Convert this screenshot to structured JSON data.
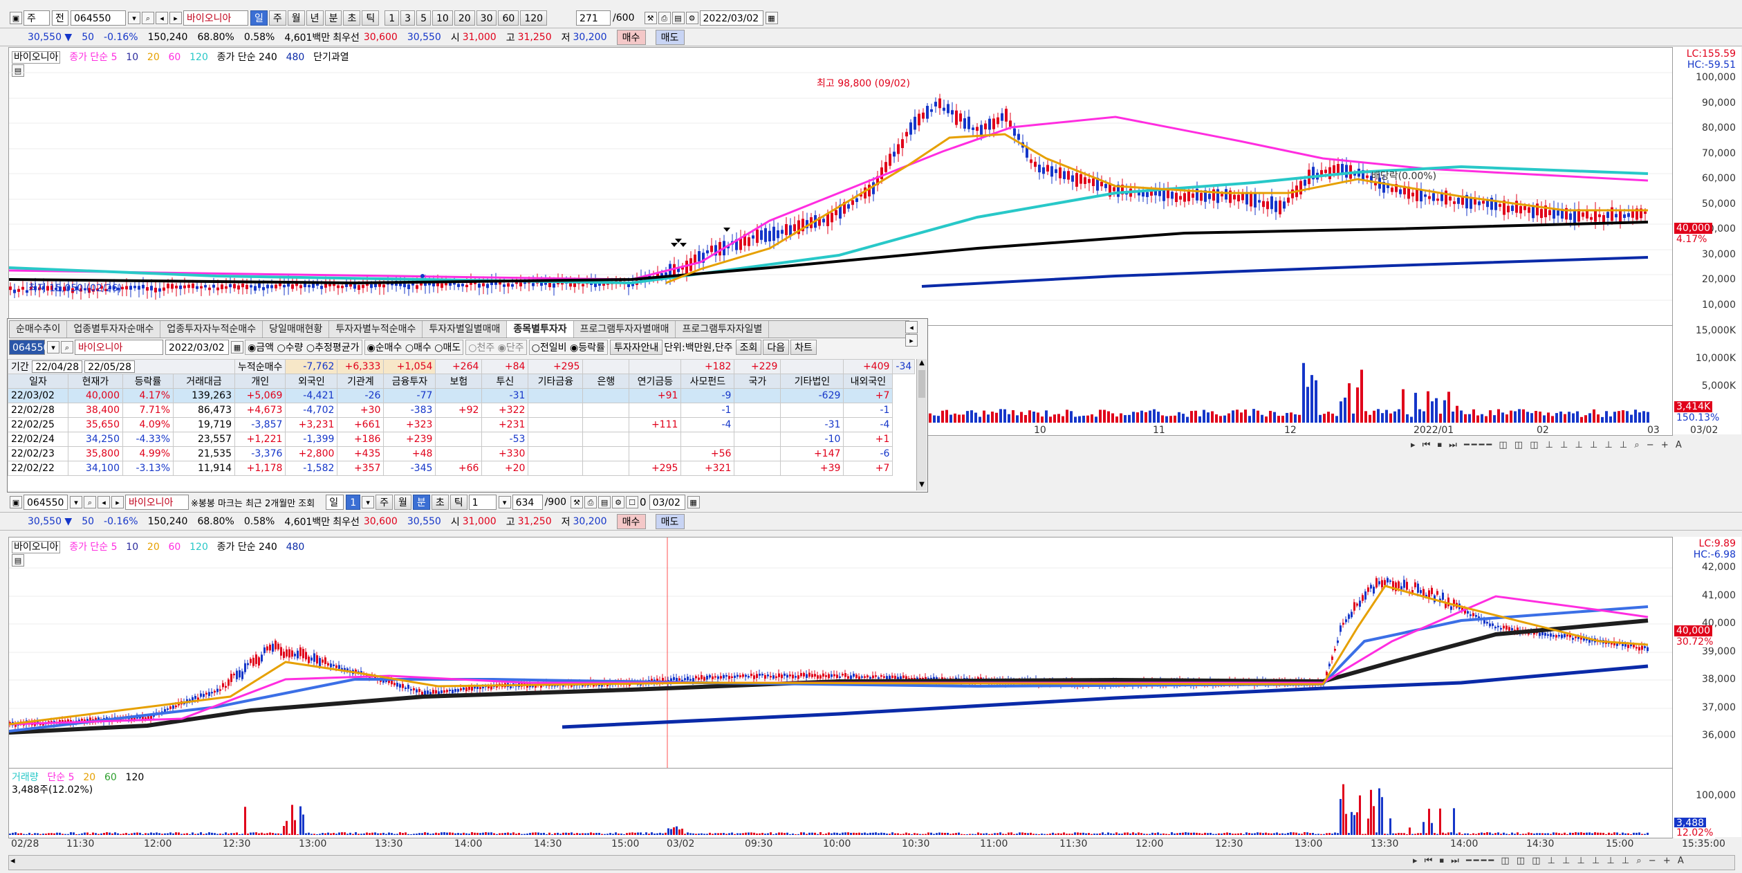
{
  "top_toolbar": {
    "type_select": "주",
    "market_select": "전",
    "code": "064550",
    "stock_name": "바이오니아",
    "periods": [
      "일",
      "주",
      "월",
      "년",
      "분",
      "초",
      "틱"
    ],
    "active_period": "일",
    "intervals": [
      "1",
      "3",
      "5",
      "10",
      "20",
      "30",
      "60",
      "120"
    ],
    "count": "271",
    "count_total": "/600",
    "date": "2022/03/02"
  },
  "quote_bar_top": {
    "price": "30,550 ▼",
    "change": "50",
    "change_pct": "-0.16%",
    "volume": "150,240",
    "vol_ratio": "68.80%",
    "turnover": "0.58%",
    "amount": "4,601백만",
    "best_label": "최우선",
    "best_ask": "30,600",
    "best_bid": "30,550",
    "open_label": "시",
    "open": "31,000",
    "high_label": "고",
    "high": "31,250",
    "low_label": "저",
    "low": "30,200",
    "buy": "매수",
    "sell": "매도"
  },
  "upper_chart": {
    "legend": {
      "name": "바이오니아",
      "ma1": "종가 단순 5",
      "ma_p": [
        "10",
        "20",
        "60",
        "120"
      ],
      "ma2": "종가 단순 240",
      "ma2_p": "480",
      "extra": "단기과열"
    },
    "lc": "LC:155.59",
    "hc": "HC:-59.51",
    "high_note": "최고 98,800 (09/02)",
    "low_note": "최저 15,050 (02/26)",
    "dividend_note": "배당락(0.00%)",
    "price_ticks": [
      "100,000",
      "90,000",
      "80,000",
      "70,000",
      "60,000",
      "50,000",
      "40,000",
      "30,000",
      "20,000",
      "10,000"
    ],
    "current_tag": "40,000",
    "current_pct": "4.17%",
    "vol_ticks": [
      "15,000K",
      "10,000K",
      "5,000K"
    ],
    "vol_tag": "3,414K",
    "vol_pct": "150.13%",
    "x_labels": [
      "10",
      "11",
      "12",
      "2022/01",
      "02",
      "03",
      "03/02"
    ]
  },
  "investor_panel": {
    "tabs": [
      "순매수추이",
      "업종별투자자순매수",
      "업종투자자누적순매수",
      "당일매매현황",
      "투자자별누적순매수",
      "투자자별일별매매",
      "종목별투자자",
      "프로그램투자자별매매",
      "프로그램투자자일별"
    ],
    "active_tab": "종목별투자자",
    "code": "064550",
    "name": "바이오니아",
    "date": "2022/03/02",
    "radio_group1": [
      "금액",
      "수량",
      "추정평균가"
    ],
    "radio_group2": [
      "순매수",
      "매수",
      "매도"
    ],
    "radio_group3": [
      "천주",
      "단주"
    ],
    "radio_group4": [
      "전일비",
      "등락률"
    ],
    "guide": "투자자안내",
    "unit": "단위:백만원,단주",
    "inquiry": "조회",
    "next": "다음",
    "chart": "차트",
    "period_label": "기간",
    "period_from": "22/04/28",
    "period_to": "22/05/28",
    "cum_label": "누적순매수",
    "cum_values": [
      "-7,762",
      "+6,333",
      "+1,054",
      "+264",
      "+84",
      "+295",
      "",
      "",
      "+182",
      "+229",
      "",
      "+409",
      "-34"
    ],
    "columns": [
      "일자",
      "현재가",
      "등락률",
      "거래대금",
      "개인",
      "외국인",
      "기관계",
      "금융투자",
      "보험",
      "투신",
      "기타금융",
      "은행",
      "연기금등",
      "사모펀드",
      "국가",
      "기타법인",
      "내외국인"
    ],
    "rows": [
      [
        "22/03/02",
        "40,000",
        "4.17%",
        "139,263",
        "+5,069",
        "-4,421",
        "-26",
        "-77",
        "",
        "-31",
        "",
        "",
        "+91",
        "-9",
        "",
        "-629",
        "+7"
      ],
      [
        "22/02/28",
        "38,400",
        "7.71%",
        "86,473",
        "+4,673",
        "-4,702",
        "+30",
        "-383",
        "+92",
        "+322",
        "",
        "",
        "",
        "-1",
        "",
        "",
        "-1"
      ],
      [
        "22/02/25",
        "35,650",
        "4.09%",
        "19,719",
        "-3,857",
        "+3,231",
        "+661",
        "+323",
        "",
        "+231",
        "",
        "",
        "+111",
        "-4",
        "",
        "-31",
        "-4"
      ],
      [
        "22/02/24",
        "34,250",
        "-4.33%",
        "23,557",
        "+1,221",
        "-1,399",
        "+186",
        "+239",
        "",
        "-53",
        "",
        "",
        "",
        "",
        "",
        "-10",
        "+1"
      ],
      [
        "22/02/23",
        "35,800",
        "4.99%",
        "21,535",
        "-3,376",
        "+2,800",
        "+435",
        "+48",
        "",
        "+330",
        "",
        "",
        "",
        "+56",
        "",
        "+147",
        "-6"
      ],
      [
        "22/02/22",
        "34,100",
        "-3.13%",
        "11,914",
        "+1,178",
        "-1,582",
        "+357",
        "-345",
        "+66",
        "+20",
        "",
        "",
        "+295",
        "+321",
        "",
        "+39",
        "+7"
      ]
    ]
  },
  "mid_toolbar": {
    "code": "064550",
    "name": "바이오니아",
    "note": "※봉봉 마크는 최근 2개월만 조회",
    "period": "일",
    "period_value": "1",
    "periods": [
      "주",
      "월",
      "분",
      "초",
      "틱"
    ],
    "active_period": "분",
    "interval": "1",
    "count": "634",
    "count_total": "/900",
    "date": "03/02"
  },
  "quote_bar_bottom": {
    "price": "30,550 ▼",
    "change": "50",
    "change_pct": "-0.16%",
    "volume": "150,240",
    "vol_ratio": "68.80%",
    "turnover": "0.58%",
    "amount": "4,601백만",
    "best_label": "최우선",
    "best_ask": "30,600",
    "best_bid": "30,550",
    "open_label": "시",
    "open": "31,000",
    "high_label": "고",
    "high": "31,250",
    "low_label": "저",
    "low": "30,200",
    "buy": "매수",
    "sell": "매도"
  },
  "lower_chart": {
    "legend": {
      "name": "바이오니아",
      "ma1": "종가 단순 5",
      "ma_p": [
        "10",
        "20",
        "60",
        "120"
      ],
      "ma2": "종가 단순 240",
      "ma2_p": "480"
    },
    "lc": "LC:9.89",
    "hc": "HC:-6.98",
    "price_ticks": [
      "42,000",
      "41,000",
      "40,000",
      "39,000",
      "38,000",
      "37,000",
      "36,000"
    ],
    "current_tag": "40,000",
    "current_pct": "30.72%",
    "vol_legend": {
      "label": "거래량",
      "ma": "단순 5",
      "p": [
        "20",
        "60",
        "120"
      ]
    },
    "vol_value": "3,488주(12.02%)",
    "vol_ticks": [
      "100,000"
    ],
    "vol_tag": "3,488",
    "vol_pct": "12.02%",
    "x_labels": [
      "02/28",
      "11:30",
      "12:00",
      "12:30",
      "13:00",
      "13:30",
      "14:00",
      "14:30",
      "15:00",
      "03/02",
      "09:30",
      "10:00",
      "10:30",
      "11:00",
      "11:30",
      "12:00",
      "12:30",
      "13:00",
      "13:30",
      "14:00",
      "14:30",
      "15:00",
      "15:35:00"
    ]
  },
  "colors": {
    "up": "#e0001a",
    "down": "#1536c9",
    "ma5": "#e6a000",
    "ma_magenta": "#ff2de0",
    "ma_cyan": "#28c8c8",
    "ma_black": "#000000",
    "ma_navy": "#0a2aa8"
  }
}
